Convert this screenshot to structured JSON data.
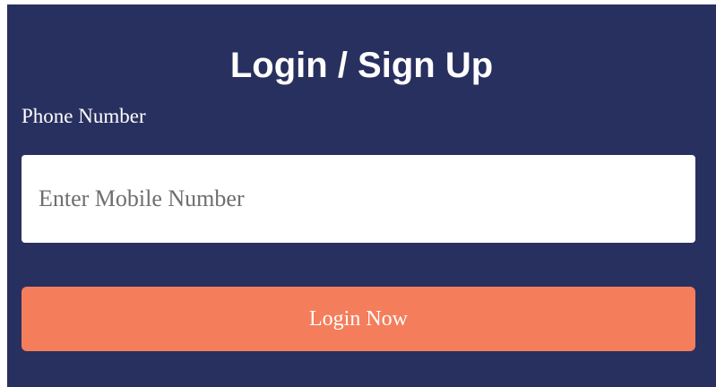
{
  "form": {
    "title": "Login / Sign Up",
    "phone_label": "Phone Number",
    "phone_placeholder": "Enter Mobile Number",
    "phone_value": "",
    "submit_label": "Login Now"
  },
  "colors": {
    "panel_background": "#28305f",
    "button_background": "#f47e5c",
    "text": "#ffffff"
  }
}
